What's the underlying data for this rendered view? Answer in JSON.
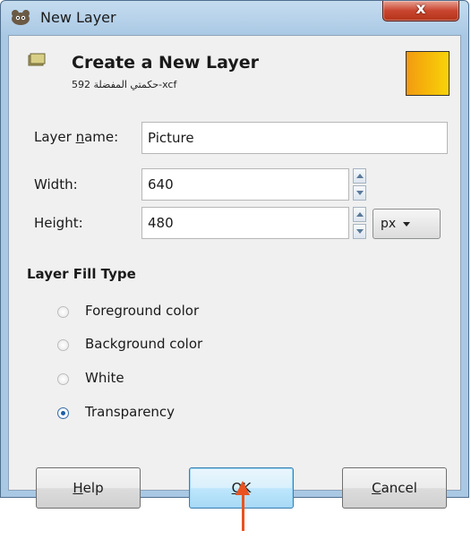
{
  "window": {
    "title": "New Layer",
    "close_label": "x"
  },
  "header": {
    "title": "Create a New Layer",
    "subtitle": "حكمتي المفضلة 592-xcf",
    "swatch_colors": [
      "#f29a13",
      "#f7d30a"
    ]
  },
  "form": {
    "layer_name": {
      "label_pre": "Layer ",
      "label_mnemonic": "n",
      "label_post": "ame:",
      "value": "Picture"
    },
    "width": {
      "label": "Width:",
      "value": "640"
    },
    "height": {
      "label": "Height:",
      "value": "480"
    },
    "unit": {
      "value": "px"
    }
  },
  "fill_type": {
    "heading": "Layer Fill Type",
    "options": [
      {
        "label": "Foreground color",
        "selected": false
      },
      {
        "label": "Background color",
        "selected": false
      },
      {
        "label": "White",
        "selected": false
      },
      {
        "label": "Transparency",
        "selected": true
      }
    ]
  },
  "buttons": {
    "help": {
      "mnemonic": "H",
      "rest": "elp"
    },
    "ok": {
      "mnemonic": "O",
      "rest": "K"
    },
    "cancel": {
      "mnemonic": "C",
      "rest": "ancel"
    }
  },
  "colors": {
    "annotation_arrow": "#e8531f",
    "default_button": "#3c7fb1"
  }
}
